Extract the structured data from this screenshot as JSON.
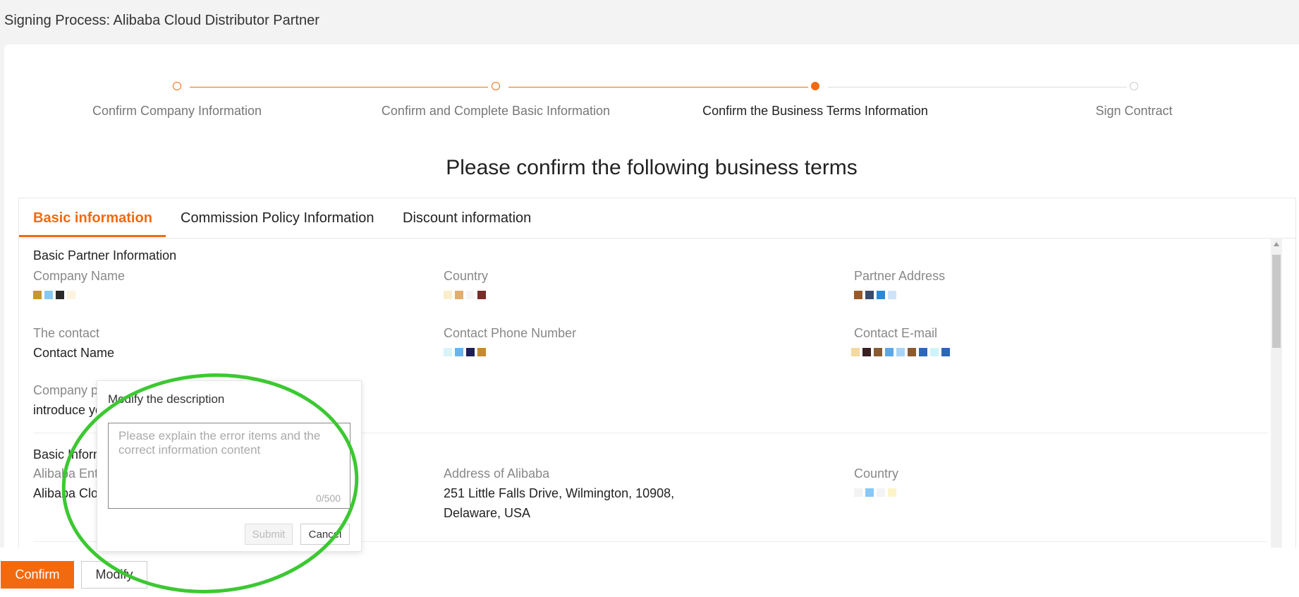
{
  "page_title": "Signing Process: Alibaba Cloud Distributor Partner",
  "colors": {
    "accent": "#f26a10",
    "annotation": "#3cc832",
    "step_inactive": "#cccccc"
  },
  "steps": [
    {
      "label": "Confirm Company Information",
      "state": "done"
    },
    {
      "label": "Confirm and Complete Basic Information",
      "state": "done"
    },
    {
      "label": "Confirm the Business Terms Information",
      "state": "current"
    },
    {
      "label": "Sign Contract",
      "state": "pending"
    }
  ],
  "heading": "Please confirm the following business terms",
  "tabs": [
    {
      "label": "Basic information",
      "active": true
    },
    {
      "label": "Commission Policy Information",
      "active": false
    },
    {
      "label": "Discount information",
      "active": false
    }
  ],
  "partner_section": {
    "title": "Basic Partner Information",
    "company_name_label": "Company Name",
    "country_label": "Country",
    "address_label": "Partner Address",
    "contact_label": "The contact",
    "contact_value": "Contact Name",
    "phone_label": "Contact Phone Number",
    "email_label": "Contact E-mail",
    "profile_label_visible": "Company p",
    "profile_value_visible": "introduce yo"
  },
  "alibaba_section": {
    "title_visible": "Basic Inform",
    "entity_label_visible": "Alibaba Ent",
    "entity_value_visible": "Alibaba Clo",
    "address_label": "Address of Alibaba",
    "address_value_line1": "251 Little Falls Drive, Wilmington, 10908,",
    "address_value_line2": "Delaware, USA",
    "country_label": "Country"
  },
  "modify_popover": {
    "title": "Modify the description",
    "placeholder": "Please explain the error items and the correct information content",
    "counter": "0/500",
    "submit_label": "Submit",
    "cancel_label": "Cancel"
  },
  "footer": {
    "confirm_label": "Confirm",
    "modify_label": "Modify"
  }
}
